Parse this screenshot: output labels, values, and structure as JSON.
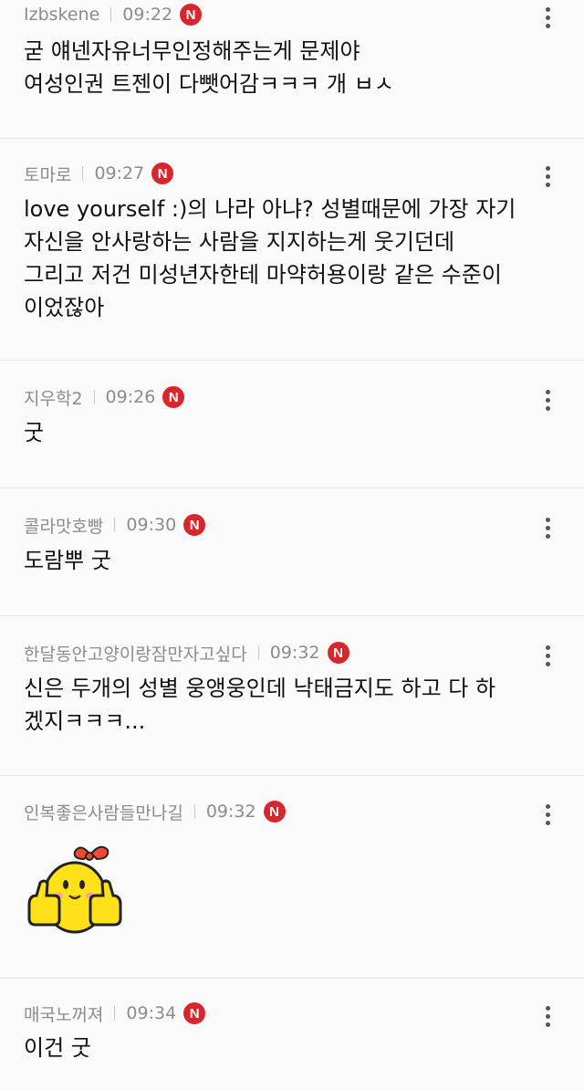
{
  "badge_letter": "N",
  "badge_color": "#d9262c",
  "more_icon": "vertical-dots-icon",
  "comments": [
    {
      "author": "Izbskene",
      "time": "09:22",
      "lines": [
        "굳 얘넨자유너무인정해주는게 문제야",
        "여성인권 트젠이 다뺏어감ㅋㅋㅋ 개 ㅂㅅ"
      ]
    },
    {
      "author": "토마로",
      "time": "09:27",
      "lines": [
        "love yourself :)의 나라 아냐? 성별때문에 가장 자기",
        "자신을 안사랑하는 사람을 지지하는게 웃기던데",
        "그리고 저건 미성년자한테 마약허용이랑 같은 수준이",
        "이었잖아"
      ]
    },
    {
      "author": "지우학2",
      "time": "09:26",
      "lines": [
        "굿"
      ]
    },
    {
      "author": "콜라맛호빵",
      "time": "09:30",
      "lines": [
        "도람뿌 굿"
      ]
    },
    {
      "author": "한달동안고양이랑잠만자고싶다",
      "time": "09:32",
      "lines": [
        "신은 두개의 성별 웅앵웅인데 낙태금지도 하고 다 하",
        "겠지ㅋㅋㅋ..."
      ]
    },
    {
      "author": "인복좋은사람들만나길",
      "time": "09:32",
      "sticker": "yellow-chick-thumbs-up-sticker"
    },
    {
      "author": "매국노꺼져",
      "time": "09:34",
      "lines": [
        "이건 굿"
      ]
    }
  ]
}
